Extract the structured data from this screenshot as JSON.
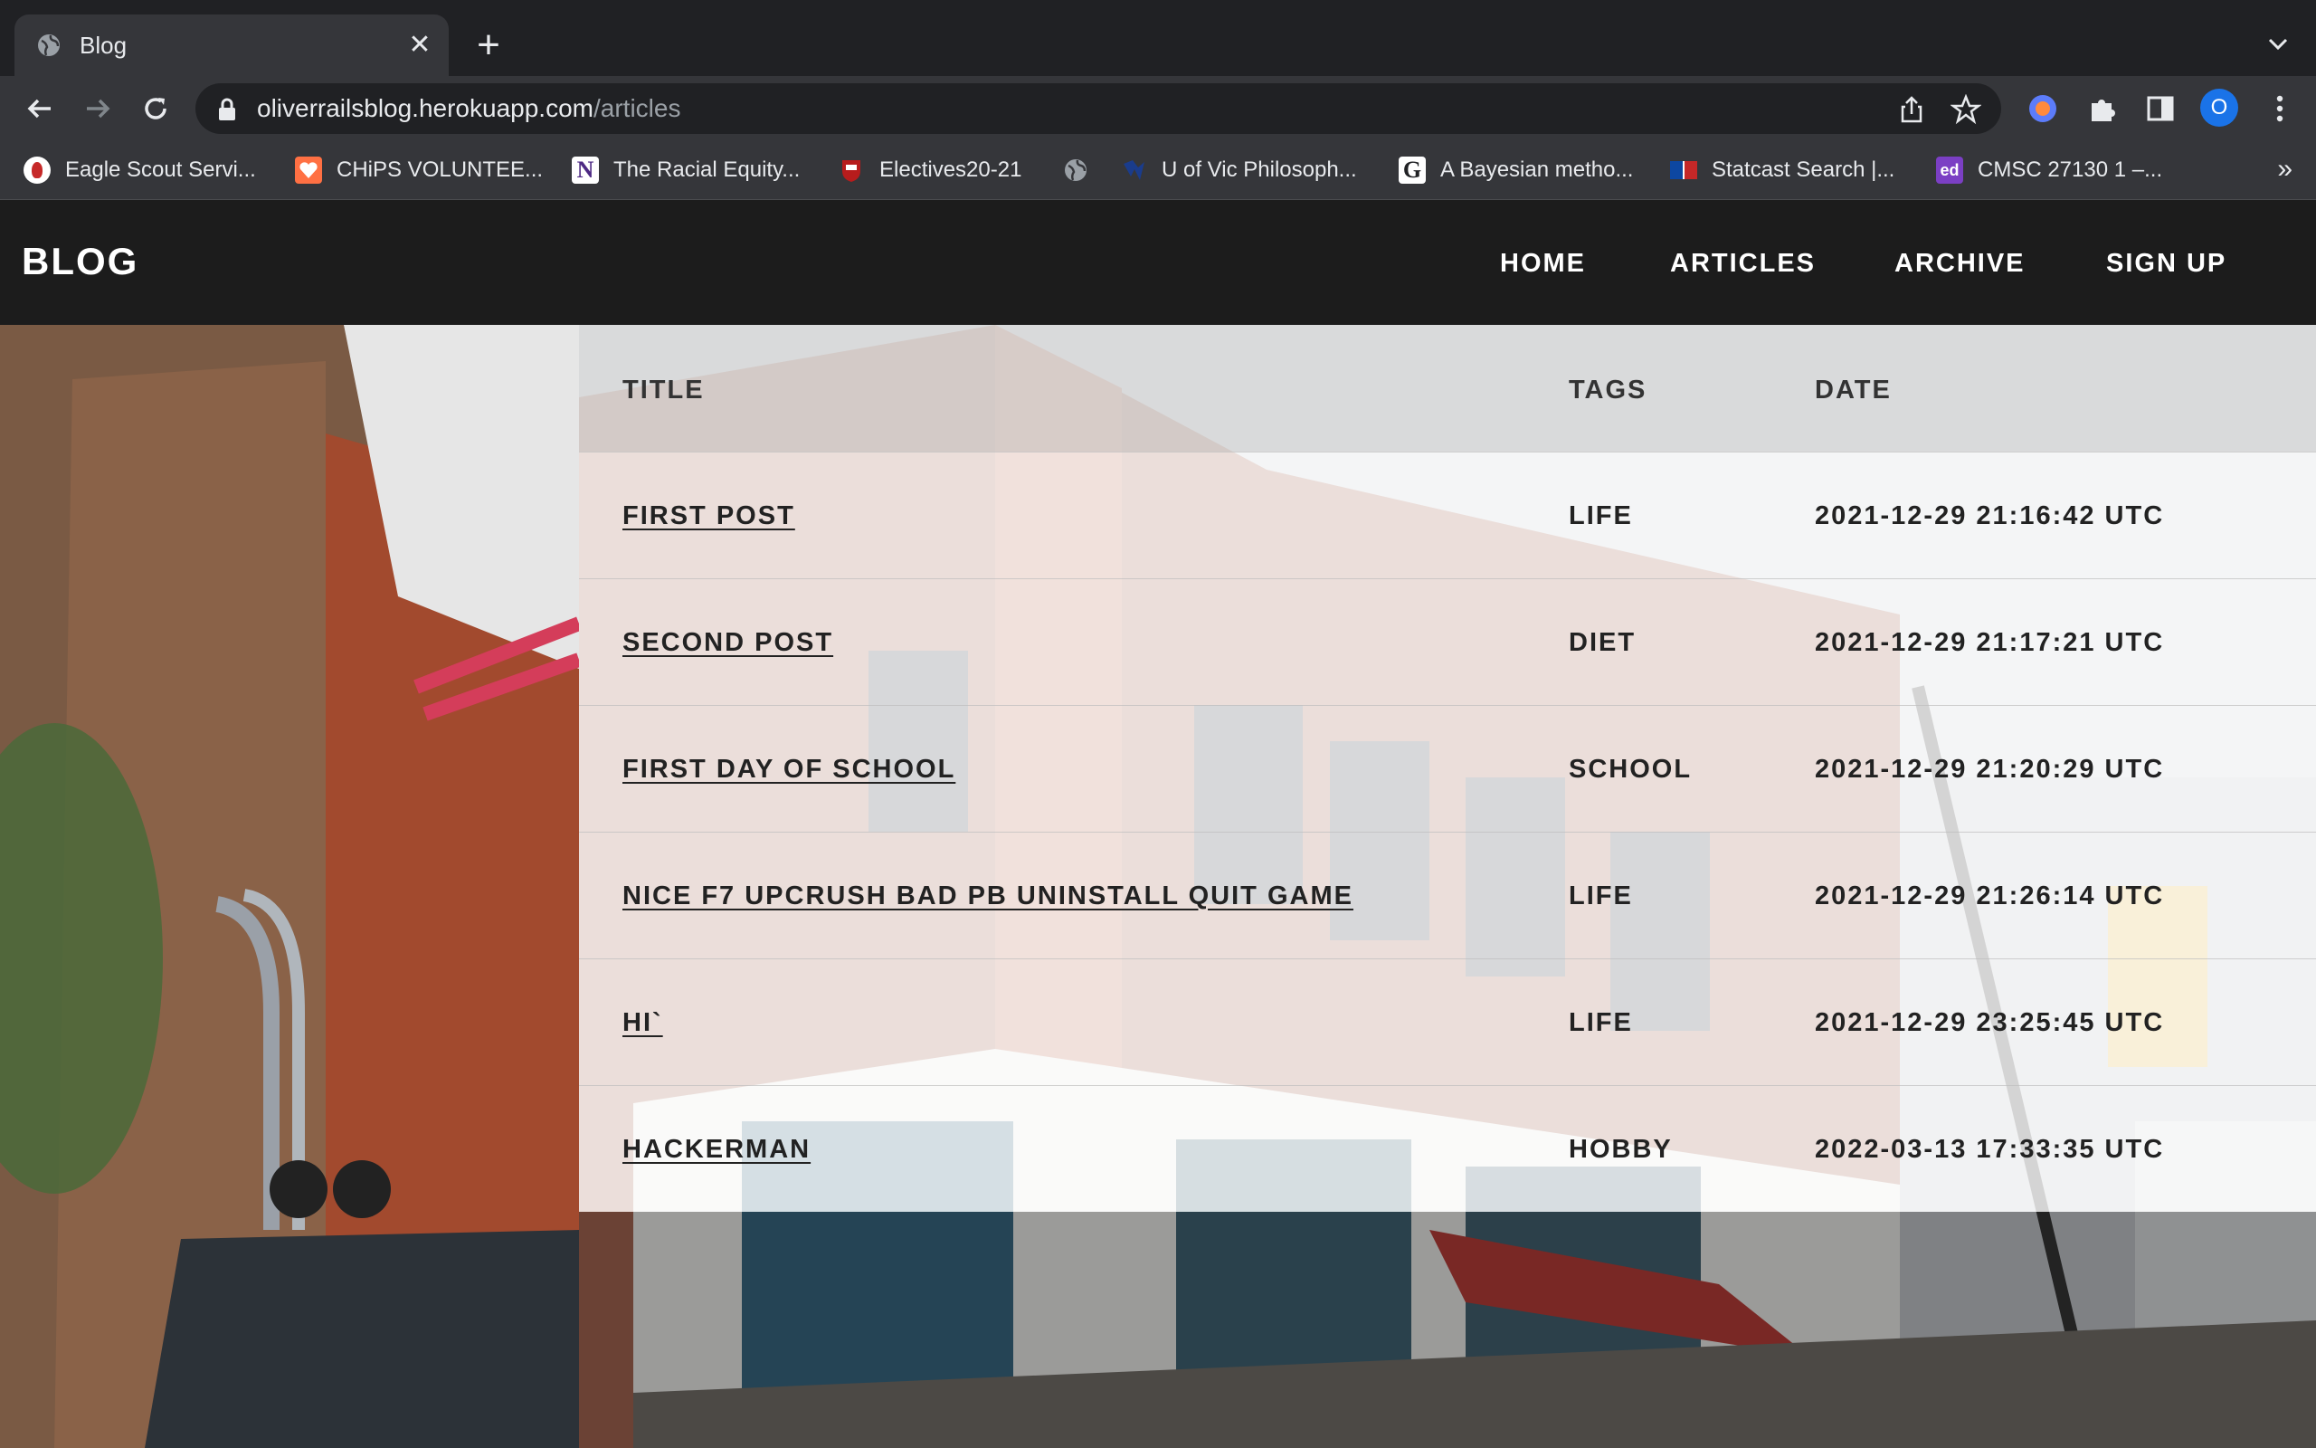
{
  "browser": {
    "tab": {
      "title": "Blog",
      "close_label": "✕"
    },
    "new_tab_label": "+",
    "url_host": "oliverrailsblog.herokuapp.com",
    "url_path": "/articles",
    "profile_initial": "O",
    "bookmarks": [
      {
        "label": "Eagle Scout Servi...",
        "icon": "scout-icon",
        "color": "#c62828"
      },
      {
        "label": "CHiPS VOLUNTEE...",
        "icon": "heart-icon",
        "color": "#ff7043"
      },
      {
        "label": "The Racial Equity...",
        "icon": "N",
        "color": "#4e2a84"
      },
      {
        "label": "Electives20-21",
        "icon": "crest-icon",
        "color": "#b71c1c"
      },
      {
        "label": "",
        "icon": "globe-icon",
        "color": "#9aa0a6"
      },
      {
        "label": "U of Vic Philosoph...",
        "icon": "uvic-icon",
        "color": "#1a237e"
      },
      {
        "label": "A Bayesian metho...",
        "icon": "G",
        "color": "#e8eaed"
      },
      {
        "label": "Statcast Search |...",
        "icon": "mlb-icon",
        "color": "#0d47a1"
      },
      {
        "label": "CMSC 27130 1 –...",
        "icon": "ed",
        "color": "#7b3fc4"
      }
    ],
    "bookmarks_more": "»"
  },
  "site": {
    "brand": "BLOG",
    "nav": [
      "HOME",
      "ARTICLES",
      "ARCHIVE",
      "SIGN UP"
    ]
  },
  "table": {
    "headers": [
      "TITLE",
      "TAGS",
      "DATE"
    ],
    "rows": [
      {
        "title": "FIRST POST",
        "tag": "LIFE",
        "date": "2021-12-29 21:16:42 UTC"
      },
      {
        "title": "SECOND POST",
        "tag": "DIET",
        "date": "2021-12-29 21:17:21 UTC"
      },
      {
        "title": "FIRST DAY OF SCHOOL",
        "tag": "SCHOOL",
        "date": "2021-12-29 21:20:29 UTC"
      },
      {
        "title": "NICE F7 UPCRUSH BAD PB UNINSTALL QUIT GAME",
        "tag": "LIFE",
        "date": "2021-12-29 21:26:14 UTC"
      },
      {
        "title": "HI`",
        "tag": "LIFE",
        "date": "2021-12-29 23:25:45 UTC"
      },
      {
        "title": "HACKERMAN",
        "tag": "HOBBY",
        "date": "2022-03-13 17:33:35 UTC"
      }
    ]
  }
}
